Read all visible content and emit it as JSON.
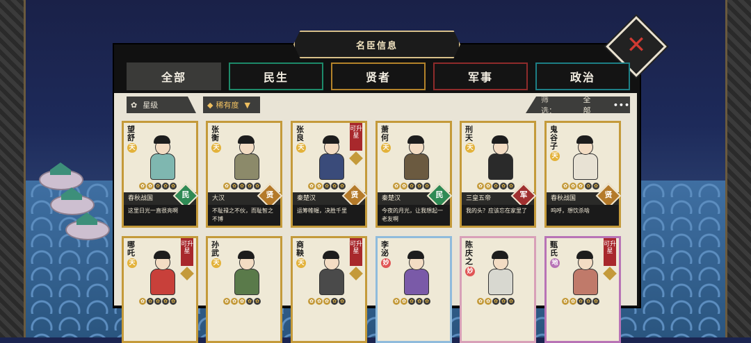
{
  "header": {
    "title": "名臣信息"
  },
  "tabs": [
    {
      "label": "全部"
    },
    {
      "label": "民生"
    },
    {
      "label": "贤者"
    },
    {
      "label": "军事"
    },
    {
      "label": "政治"
    }
  ],
  "sort": {
    "star_label": "星级",
    "rarity_label": "稀有度"
  },
  "filter": {
    "label": "筛选：",
    "value": "全部",
    "more": "•••"
  },
  "upgrade_label": "可升星",
  "cards": [
    {
      "name": "望舒",
      "rank": "天",
      "dynasty": "春秋战国",
      "category": "民",
      "quote": "这里日光一直很亮啊",
      "upgrade": false,
      "stars": 2,
      "outfit": "#7fb7b0"
    },
    {
      "name": "张衡",
      "rank": "天",
      "dynasty": "大汉",
      "category": "贤",
      "quote": "不耻禄之不伙，而耻智之不博",
      "upgrade": false,
      "stars": 1,
      "outfit": "#8c8a6a"
    },
    {
      "name": "张良",
      "rank": "天",
      "dynasty": "秦楚汉",
      "category": "贤",
      "quote": "运筹帷幄，决胜千里",
      "upgrade": true,
      "stars": 2,
      "outfit": "#3a4b7a"
    },
    {
      "name": "萧何",
      "rank": "天",
      "dynasty": "秦楚汉",
      "category": "民",
      "quote": "今夜的月光，让我想起一老友啊",
      "upgrade": false,
      "stars": 2,
      "outfit": "#6b5a40"
    },
    {
      "name": "刑天",
      "rank": "天",
      "dynasty": "三皇五帝",
      "category": "军",
      "quote": "我的头？应该忘在家里了",
      "upgrade": false,
      "stars": 2,
      "outfit": "#2a2a2a"
    },
    {
      "name": "鬼谷子",
      "rank": "天",
      "dynasty": "春秋战国",
      "category": "贤",
      "quote": "呜呼，想饮杀啥",
      "upgrade": false,
      "stars": 3,
      "outfit": "#e8e2d4"
    },
    {
      "name": "哪吒",
      "rank": "天",
      "dynasty": "",
      "category": "",
      "quote": "",
      "upgrade": true,
      "stars": 1,
      "outfit": "#c8403a"
    },
    {
      "name": "孙武",
      "rank": "天",
      "dynasty": "",
      "category": "",
      "quote": "",
      "upgrade": false,
      "stars": 3,
      "outfit": "#5a7a4a"
    },
    {
      "name": "商鞅",
      "rank": "天",
      "dynasty": "",
      "category": "",
      "quote": "",
      "upgrade": true,
      "stars": 3,
      "outfit": "#4a4a4a"
    },
    {
      "name": "李泌",
      "rank": "妙",
      "dynasty": "",
      "category": "",
      "quote": "",
      "upgrade": false,
      "stars": 2,
      "outfit": "#7a5aa8"
    },
    {
      "name": "陈庆之",
      "rank": "妙",
      "dynasty": "",
      "category": "",
      "quote": "",
      "upgrade": false,
      "stars": 2,
      "outfit": "#d8d8d0"
    },
    {
      "name": "甄氏",
      "rank": "地",
      "dynasty": "",
      "category": "",
      "quote": "",
      "upgrade": true,
      "stars": 2,
      "outfit": "#c07a6a"
    }
  ]
}
